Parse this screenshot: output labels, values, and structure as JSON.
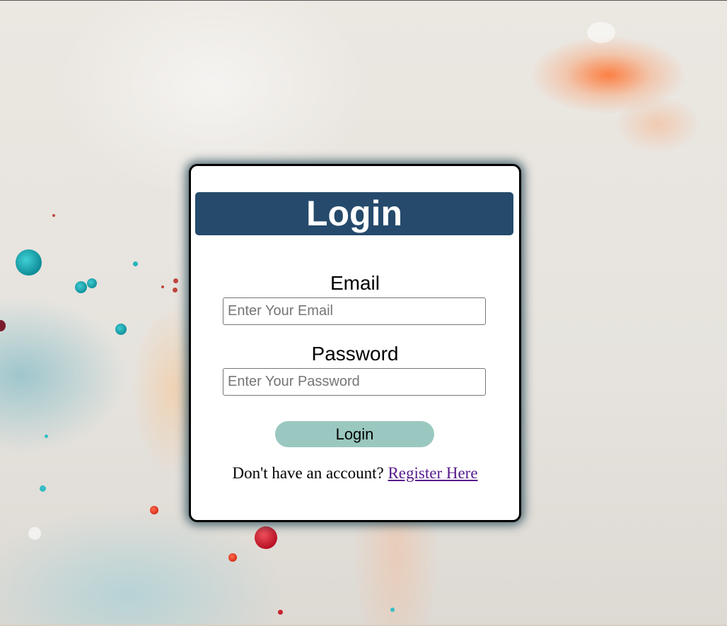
{
  "page": {
    "background_accent_colors": [
      "#ff6e28",
      "#1fa9b4",
      "#d9202f"
    ]
  },
  "login_card": {
    "title": "Login",
    "title_bg_color": "#254a6b",
    "email": {
      "label": "Email",
      "placeholder": "Enter Your Email",
      "value": ""
    },
    "password": {
      "label": "Password",
      "placeholder": "Enter Your Password",
      "value": ""
    },
    "submit_label": "Login",
    "submit_color": "#9ac8c0",
    "register_prompt": "Don't have an account?",
    "register_link_text": "Register Here",
    "link_color": "#551a8b"
  }
}
